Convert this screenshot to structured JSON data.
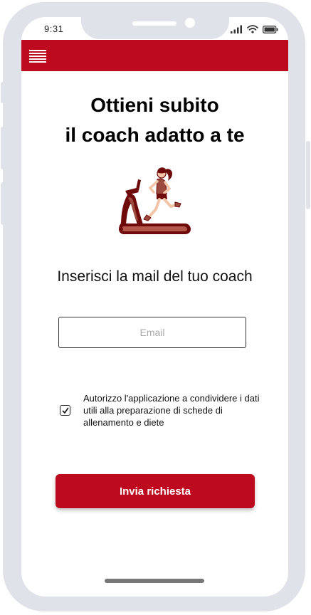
{
  "status_bar": {
    "time": "9:31"
  },
  "app_bar": {
    "menu_icon": "hamburger-menu-icon",
    "color": "#bd0a1e"
  },
  "main": {
    "title_line1": "Ottieni subito",
    "title_line2": "il coach adatto a te",
    "illustration": "woman-running-on-treadmill",
    "subtitle": "Inserisci la mail del tuo coach",
    "email": {
      "value": "",
      "placeholder": "Email"
    },
    "consent": {
      "checked": true,
      "text": "Autorizzo l'applicazione a condividere i dati utili alla preparazione di schede di allenamento e diete"
    },
    "submit_label": "Invia richiesta"
  },
  "colors": {
    "accent": "#bd0a1e",
    "illustration_dark": "#6e0a0a",
    "illustration_mid": "#9c4a3d",
    "frame": "#dfe2e8"
  }
}
